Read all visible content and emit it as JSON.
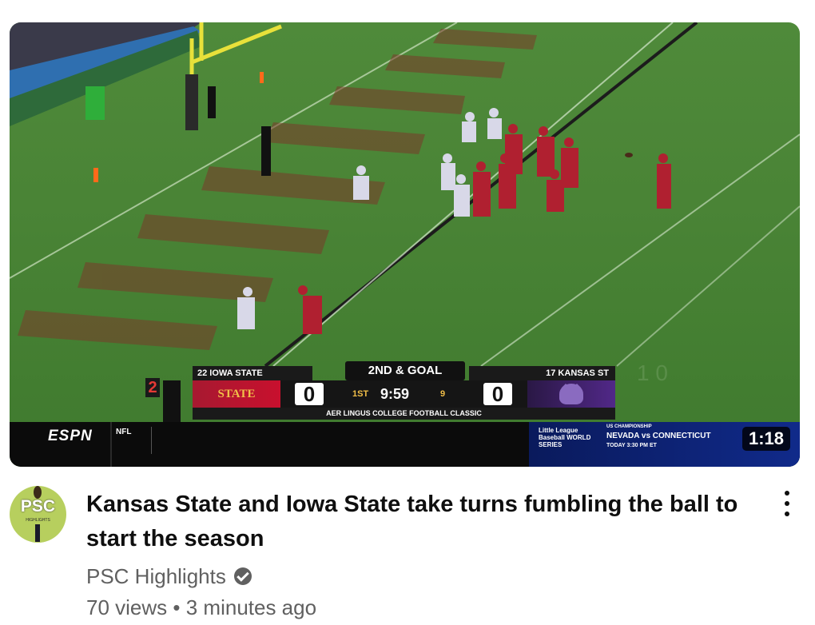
{
  "video": {
    "duration": "1:18",
    "scorebug": {
      "away_team": "22 IOWA STATE",
      "home_team": "17 KANSAS ST",
      "down_distance": "2ND & GOAL",
      "away_logo_text": "STATE",
      "away_score": "0",
      "home_score": "0",
      "quarter": "1ST",
      "clock": "9:59",
      "play_clock": "9",
      "event": "AER LINGUS COLLEGE FOOTBALL CLASSIC",
      "down_marker": "2"
    },
    "broadcast": {
      "network": "ESPN",
      "ticker_league": "NFL",
      "promo_logo": "Little League Baseball WORLD SERIES",
      "promo_kicker": "US CHAMPIONSHIP",
      "promo_matchup": "NEVADA vs CONNECTICUT",
      "promo_time": "TODAY 3:30 PM ET"
    },
    "title": "Kansas State and Iowa State take turns fumbling the ball to start the season",
    "channel": {
      "name": "PSC Highlights",
      "avatar_text": "PSC",
      "avatar_subtext": "HIGHLIGHTS",
      "verified": true
    },
    "stats": {
      "views": "70 views",
      "separator": "•",
      "age": "3 minutes ago"
    }
  },
  "icons": {
    "verified": "verified-check-icon",
    "menu": "more-vert-icon"
  },
  "colors": {
    "iowa_state_red": "#c8102e",
    "iowa_state_gold": "#f1be48",
    "kansas_state_purple": "#512888",
    "meta_text": "#606060",
    "title_text": "#0f0f0f"
  }
}
